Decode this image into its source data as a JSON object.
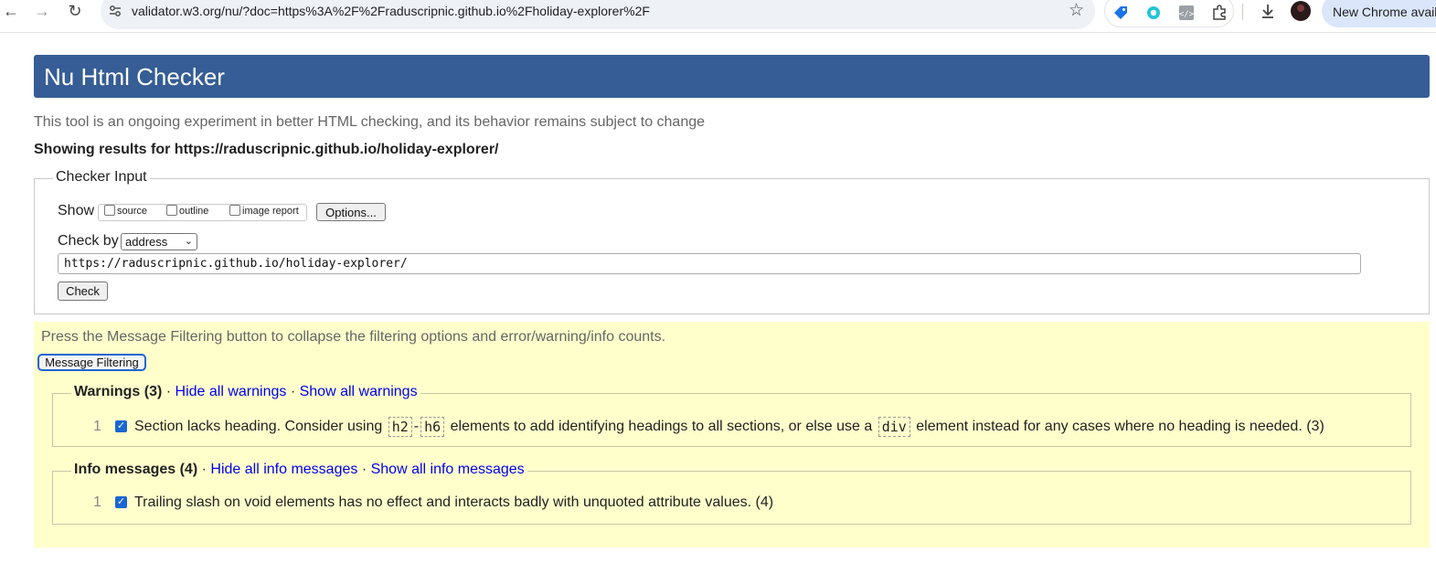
{
  "browser": {
    "url": "validator.w3.org/nu/?doc=https%3A%2F%2Fraduscripnic.github.io%2Fholiday-explorer%2F",
    "new_chrome_label": "New Chrome avail"
  },
  "header": {
    "title": "Nu Html Checker"
  },
  "intro_text": "This tool is an ongoing experiment in better HTML checking, and its behavior remains subject to change",
  "showing_results": "Showing results for https://raduscripnic.github.io/holiday-explorer/",
  "checker_input": {
    "legend": "Checker Input",
    "show_label": "Show",
    "show_options": [
      "source",
      "outline",
      "image report"
    ],
    "options_button": "Options...",
    "check_by_label": "Check by",
    "check_by_value": "address",
    "url_value": "https://raduscripnic.github.io/holiday-explorer/",
    "check_button": "Check"
  },
  "filtering": {
    "note": "Press the Message Filtering button to collapse the filtering options and error/warning/info counts.",
    "button": "Message Filtering",
    "separator": "·",
    "warnings": {
      "title": "Warnings (3)",
      "hide_link": "Hide all warnings",
      "show_link": "Show all warnings",
      "row": {
        "num": "1",
        "text_1": "Section lacks heading. Consider using",
        "code_1": "h2",
        "dash": "-",
        "code_2": "h6",
        "text_2": "elements to add identifying headings to all sections, or else use a",
        "code_3": "div",
        "text_3": "element instead for any cases where no heading is needed. (3)"
      }
    },
    "info": {
      "title": "Info messages (4)",
      "hide_link": "Hide all info messages",
      "show_link": "Show all info messages",
      "row": {
        "num": "1",
        "text": "Trailing slash on void elements has no effect and interacts badly with unquoted attribute values. (4)"
      }
    }
  }
}
